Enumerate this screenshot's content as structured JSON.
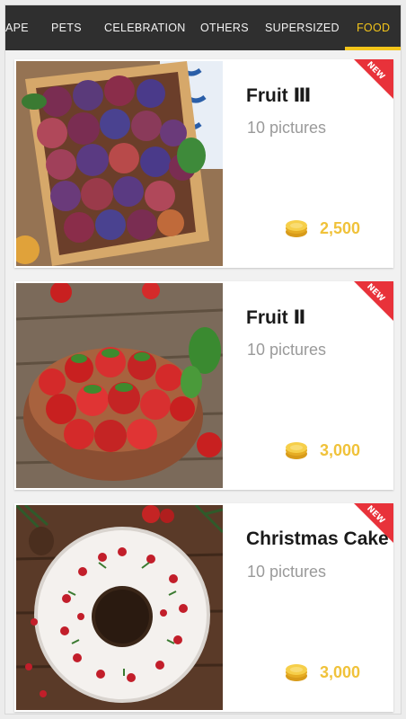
{
  "tabs": [
    {
      "label": "APE"
    },
    {
      "label": "PETS"
    },
    {
      "label": "CELEBRATION"
    },
    {
      "label": "OTHERS"
    },
    {
      "label": "SUPERSIZED"
    },
    {
      "label": "FOOD",
      "active": true
    }
  ],
  "accent_color": "#f3c51a",
  "price_color": "#f0c23a",
  "badge_color": "#e8323a",
  "cards": [
    {
      "title": "Fruit Ⅲ",
      "subtitle": "10 pictures",
      "price": "2,500",
      "badge": "NEW",
      "image": "plums-in-wooden-crate"
    },
    {
      "title": "Fruit Ⅱ",
      "subtitle": "10 pictures",
      "price": "3,000",
      "badge": "NEW",
      "image": "strawberries-in-bowl"
    },
    {
      "title": "Christmas Cake",
      "subtitle": "10 pictures",
      "price": "3,000",
      "badge": "NEW",
      "image": "iced-bundt-cake"
    }
  ]
}
